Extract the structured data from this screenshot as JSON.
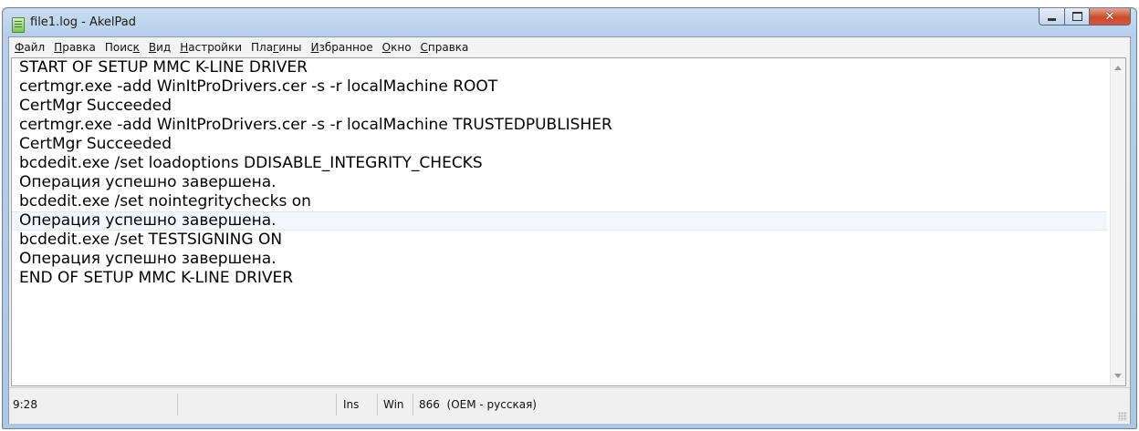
{
  "window": {
    "title": "file1.log - AkelPad"
  },
  "menu": [
    {
      "prefix": "",
      "underline": "Ф",
      "rest": "айл"
    },
    {
      "prefix": "",
      "underline": "П",
      "rest": "равка"
    },
    {
      "prefix": "Поис",
      "underline": "к",
      "rest": ""
    },
    {
      "prefix": "",
      "underline": "В",
      "rest": "ид"
    },
    {
      "prefix": "",
      "underline": "Н",
      "rest": "астройки"
    },
    {
      "prefix": "Пла",
      "underline": "г",
      "rest": "ины"
    },
    {
      "prefix": "",
      "underline": "И",
      "rest": "збранное"
    },
    {
      "prefix": "",
      "underline": "О",
      "rest": "кно"
    },
    {
      "prefix": "",
      "underline": "С",
      "rest": "правка"
    }
  ],
  "editor": {
    "lines": [
      "START OF SETUP MMC K-LINE DRIVER",
      "certmgr.exe -add WinItProDrivers.cer -s -r localMachine ROOT",
      "CertMgr Succeeded",
      "certmgr.exe -add WinItProDrivers.cer -s -r localMachine TRUSTEDPUBLISHER",
      "CertMgr Succeeded",
      "bcdedit.exe /set loadoptions DDISABLE_INTEGRITY_CHECKS",
      "Операция успешно завершена.",
      "bcdedit.exe /set nointegritychecks on",
      "Операция успешно завершена.",
      "bcdedit.exe /set TESTSIGNING ON",
      "Операция успешно завершена.",
      "END OF SETUP MMC K-LINE DRIVER"
    ],
    "current_line_index": 8
  },
  "status": {
    "position": "9:28",
    "insert_mode": "Ins",
    "line_ending": "Win",
    "codepage": "866  (OEM - русская)"
  },
  "icons": [
    "app-icon",
    "minimize-icon",
    "maximize-icon",
    "close-icon",
    "scroll-up-icon",
    "scroll-down-icon",
    "size-grip-icon"
  ]
}
